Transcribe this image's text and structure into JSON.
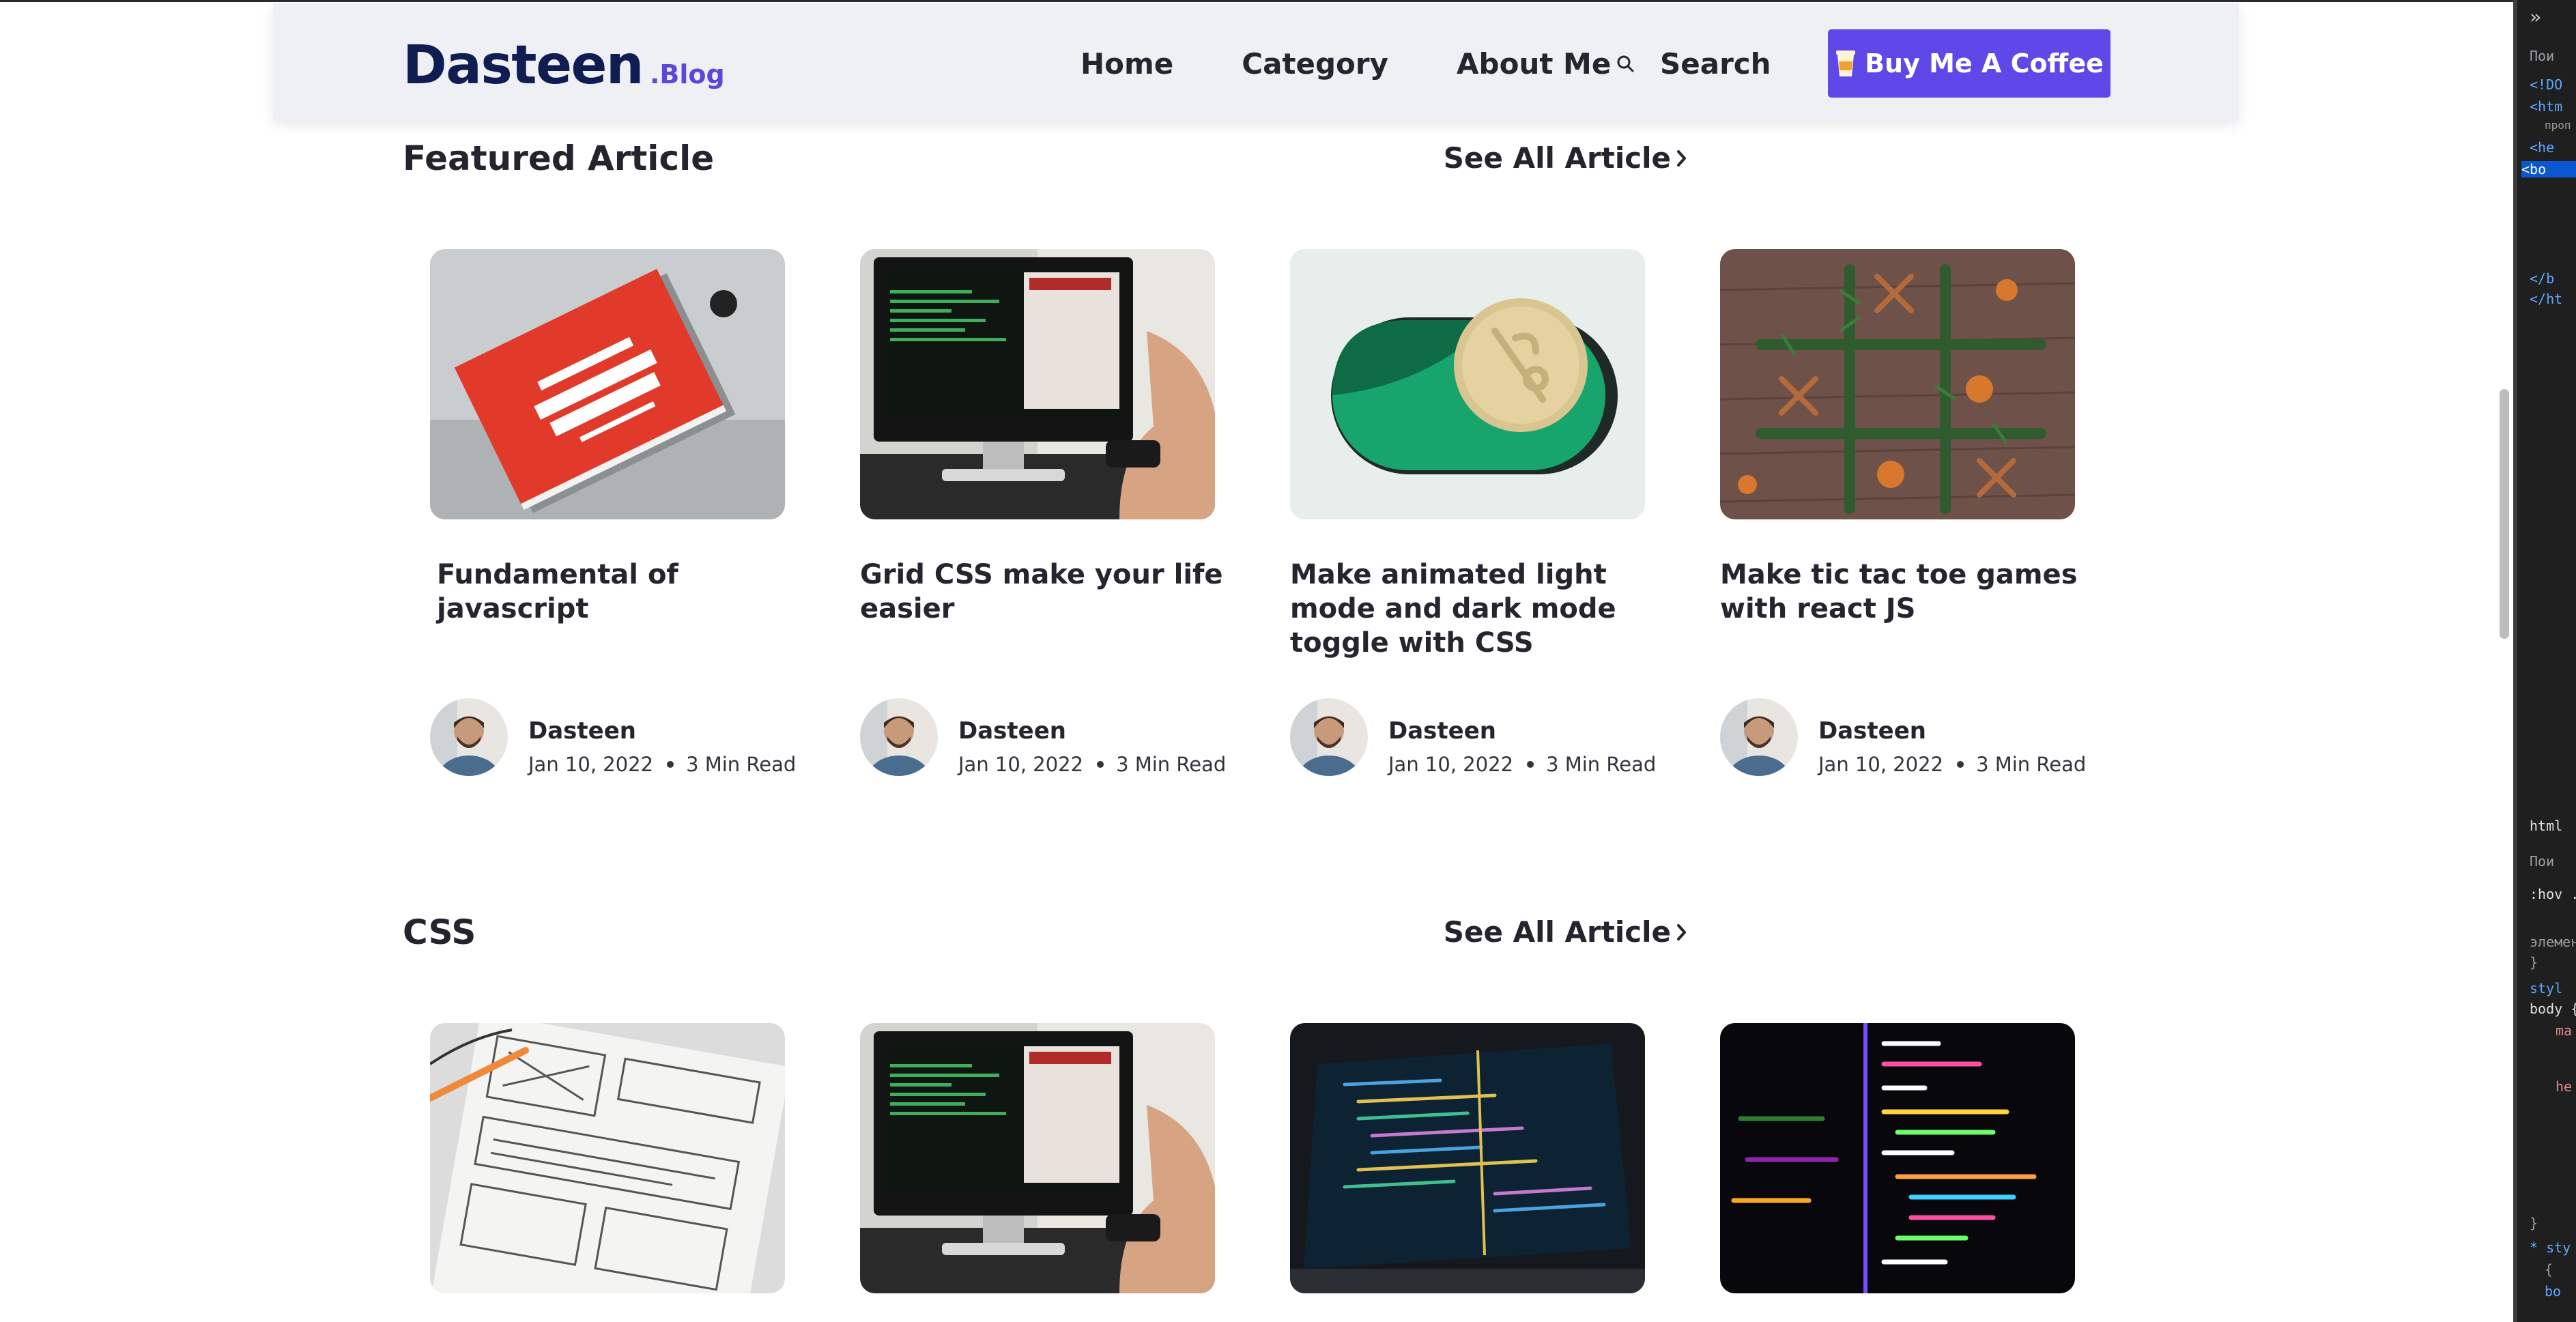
{
  "header": {
    "logo_main": "Dasteen",
    "logo_sub": ".Blog",
    "nav": [
      "Home",
      "Category",
      "About Me"
    ],
    "search_label": "Search",
    "cta_label": "Buy Me A Coffee"
  },
  "sections": [
    {
      "title": "Featured Article",
      "see_all": "See All Article",
      "cards": [
        {
          "title": "Fundamental of javascript",
          "author": "Dasteen",
          "date": "Jan 10, 2022",
          "read": "3 Min Read",
          "image": "red javascript book"
        },
        {
          "title": "Grid CSS make your life easier",
          "author": "Dasteen",
          "date": "Jan 10, 2022",
          "read": "3 Min Read",
          "image": "desktop computer with code"
        },
        {
          "title": "Make animated light mode and dark mode toggle with CSS",
          "author": "Dasteen",
          "date": "Jan 10, 2022",
          "read": "3 Min Read",
          "image": "green toggle switch"
        },
        {
          "title": "Make tic tac toe games with react JS",
          "author": "Dasteen",
          "date": "Jan 10, 2022",
          "read": "3 Min Read",
          "image": "pine branches tic tac toe"
        }
      ]
    },
    {
      "title": "CSS",
      "see_all": "See All Article",
      "cards": [
        {
          "image": "wireframe sketches on paper"
        },
        {
          "image": "desktop computer with code"
        },
        {
          "image": "laptop code editor"
        },
        {
          "image": "colorful code on dark screen"
        }
      ]
    }
  ],
  "devtools": {
    "lines": [
      "<!DO",
      "<htm",
      "проп",
      "<he",
      "<bo",
      "</b",
      "</ht",
      "html",
      "Пои",
      ":hov .c",
      "элемен",
      "}",
      "styl",
      "body {",
      "ma",
      "he",
      "}",
      "* sty",
      "{",
      "bo"
    ]
  },
  "colors": {
    "accent": "#5e48e8",
    "logo": "#101d52",
    "header_bg": "#eef0f4"
  }
}
